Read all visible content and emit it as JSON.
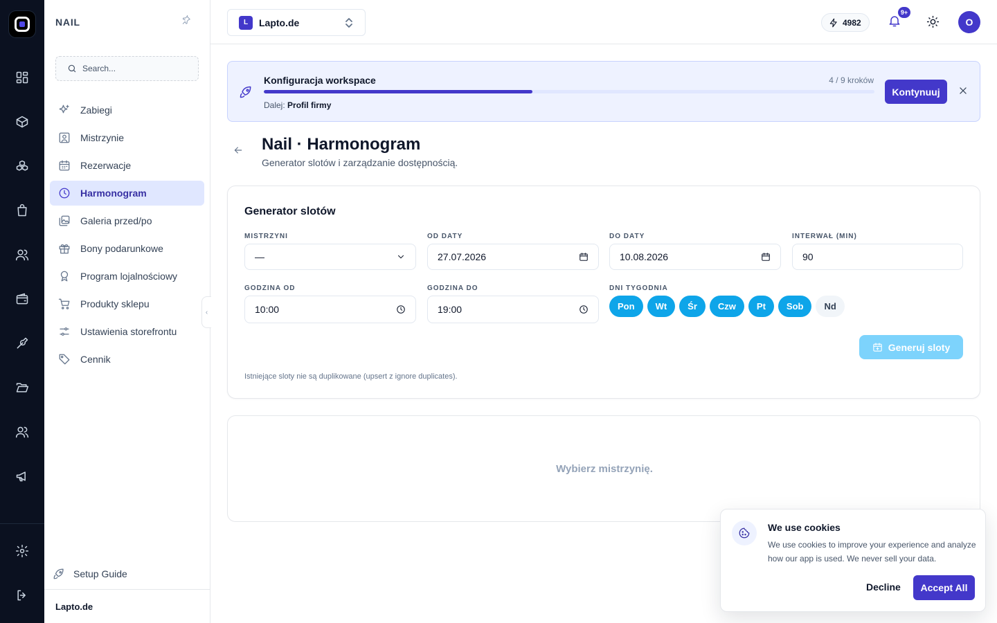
{
  "sidebar": {
    "title": "NAIL",
    "search_placeholder": "Search...",
    "items": [
      {
        "label": "Zabiegi",
        "icon": "sparkles-icon"
      },
      {
        "label": "Mistrzynie",
        "icon": "user-square-icon"
      },
      {
        "label": "Rezerwacje",
        "icon": "calendar-icon"
      },
      {
        "label": "Harmonogram",
        "icon": "clock-icon",
        "active": true
      },
      {
        "label": "Galeria przed/po",
        "icon": "images-icon"
      },
      {
        "label": "Bony podarunkowe",
        "icon": "gift-icon"
      },
      {
        "label": "Program lojalnościowy",
        "icon": "award-icon"
      },
      {
        "label": "Produkty sklepu",
        "icon": "cart-icon"
      },
      {
        "label": "Ustawienia storefrontu",
        "icon": "sliders-icon"
      },
      {
        "label": "Cennik",
        "icon": "tag-icon"
      }
    ],
    "setup_guide": "Setup Guide",
    "footer": "Lapto.de"
  },
  "header": {
    "workspace_initial": "L",
    "workspace_name": "Lapto.de",
    "credits": "4982",
    "notifications_badge": "9+",
    "avatar_initial": "O"
  },
  "banner": {
    "title": "Konfiguracja workspace",
    "steps": "4 / 9 kroków",
    "progress_percent": 44,
    "next_prefix": "Dalej:",
    "next_step": "Profil firmy",
    "continue_label": "Kontynuuj"
  },
  "page": {
    "title": "Nail · Harmonogram",
    "subtitle": "Generator slotów i zarządzanie dostępnością."
  },
  "generator": {
    "title": "Generator slotów",
    "master_label": "MISTRZYNI",
    "master_value": "—",
    "from_date_label": "OD DATY",
    "from_date_value": "27.07.2026",
    "to_date_label": "DO DATY",
    "to_date_value": "10.08.2026",
    "interval_label": "INTERWAŁ (MIN)",
    "interval_value": "90",
    "time_from_label": "GODZINA OD",
    "time_from_value": "10:00",
    "time_to_label": "GODZINA DO",
    "time_to_value": "19:00",
    "days_label": "DNI TYGODNIA",
    "days": [
      {
        "label": "Pon",
        "selected": true
      },
      {
        "label": "Wt",
        "selected": true
      },
      {
        "label": "Śr",
        "selected": true
      },
      {
        "label": "Czw",
        "selected": true
      },
      {
        "label": "Pt",
        "selected": true
      },
      {
        "label": "Sob",
        "selected": true
      },
      {
        "label": "Nd",
        "selected": false
      }
    ],
    "generate_label": "Generuj sloty",
    "note": "Istniejące sloty nie są duplikowane (upsert z ignore duplicates)."
  },
  "empty_state": "Wybierz mistrzynię.",
  "cookies": {
    "title": "We use cookies",
    "text": "We use cookies to improve your experience and analyze how our app is used. We never sell your data.",
    "decline": "Decline",
    "accept": "Accept All"
  },
  "colors": {
    "rail_bg": "#0b1120",
    "primary": "#4338ca",
    "day_selected": "#0ea5e9",
    "generate_disabled": "#7dd3fc",
    "banner_bg": "#eef2ff"
  }
}
